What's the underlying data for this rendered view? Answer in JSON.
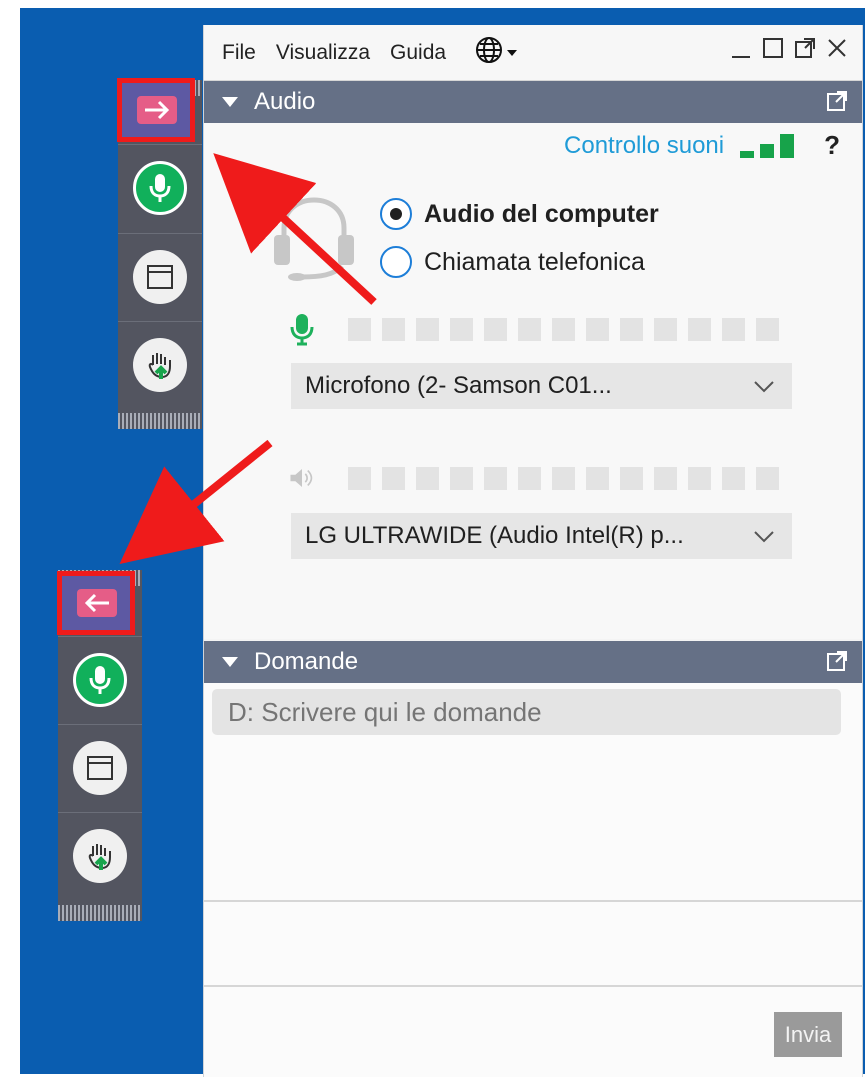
{
  "menu": {
    "file": "File",
    "view": "Visualizza",
    "guide": "Guida"
  },
  "icons": {
    "language": "globe-icon",
    "minimize": "minimize-icon",
    "maximize": "maximize-icon",
    "popout": "popout-icon",
    "close": "close-icon",
    "collapse": "caret-down-icon",
    "headset": "headset-icon",
    "microphone": "microphone-icon",
    "speaker": "speaker-icon",
    "chevron": "chevron-down-icon",
    "screen": "screen-icon",
    "hand": "hand-raise-icon",
    "arrow_right": "arrow-right-icon",
    "arrow_left": "arrow-left-icon"
  },
  "audio_panel": {
    "title": "Audio",
    "sound_check_label": "Controllo suoni",
    "help_label": "?",
    "options": [
      {
        "label": "Audio del computer",
        "selected": true
      },
      {
        "label": "Chiamata telefonica",
        "selected": false
      }
    ],
    "microphone_device": "Microfono (2- Samson C01...",
    "speaker_device": "LG ULTRAWIDE (Audio Intel(R) p..."
  },
  "questions_panel": {
    "title": "Domande",
    "input_placeholder": "D: Scrivere qui le domande",
    "send_label": "Invia"
  },
  "colors": {
    "desktop_blue": "#0a5db0",
    "header_gray": "#657086",
    "link_blue": "#1f9bd7",
    "signal_green": "#17a34a",
    "toolbar_gray": "#535560",
    "annotation_red": "#ef1b1b",
    "toggle_purple": "#5d59a3",
    "toggle_pink": "#e55d87"
  }
}
